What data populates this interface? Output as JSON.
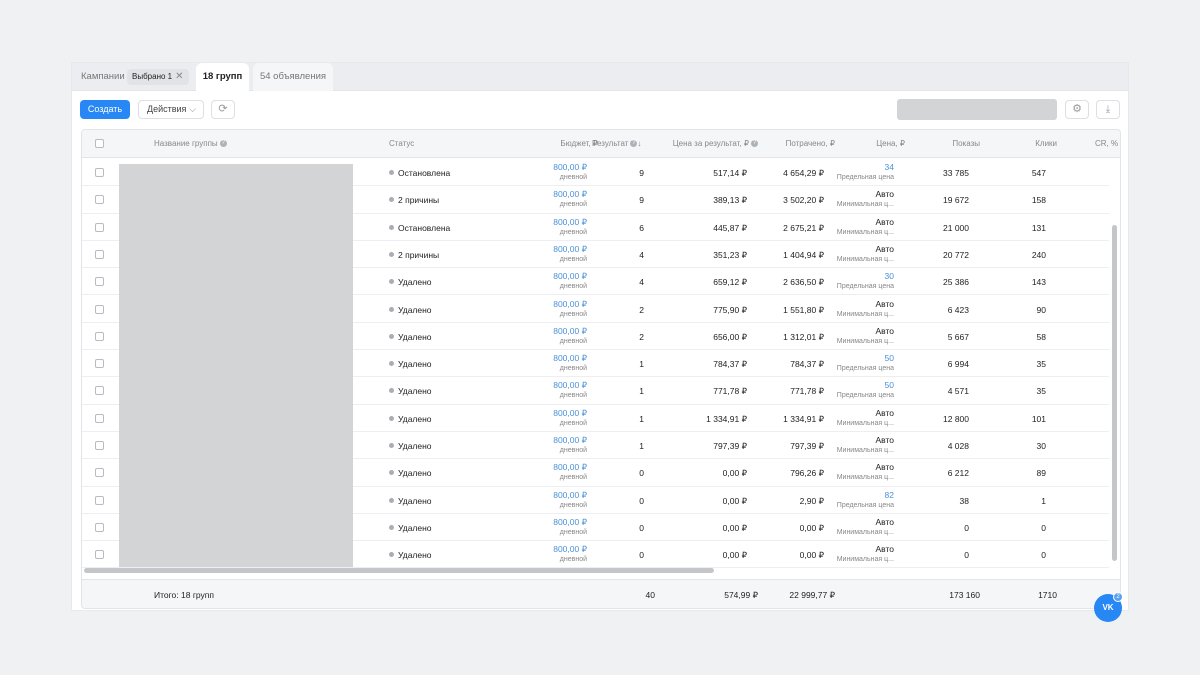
{
  "tabs": {
    "campaigns_label": "Кампании",
    "selected_chip": "Выбрано 1",
    "groups_label": "18 групп",
    "ads_label": "54 объявления"
  },
  "toolbar": {
    "create_label": "Создать",
    "actions_label": "Действия"
  },
  "table": {
    "headers": {
      "name": "Название группы",
      "status": "Статус",
      "budget": "Бюджет, ₽",
      "result": "Результат",
      "cost_per_result": "Цена за результат, ₽",
      "spent": "Потрачено, ₽",
      "price": "Цена, ₽",
      "impressions": "Показы",
      "clicks": "Клики",
      "cr": "CR, %"
    },
    "rows": [
      {
        "status": "Остановлена",
        "budget": "800,00 ₽",
        "budget_sub": "дневной",
        "result": "9",
        "cpr": "517,14 ₽",
        "spent": "4 654,29 ₽",
        "price": "34",
        "price_sub": "Предельная цена",
        "impressions": "33 785",
        "clicks": "547"
      },
      {
        "status": "2 причины",
        "budget": "800,00 ₽",
        "budget_sub": "дневной",
        "result": "9",
        "cpr": "389,13 ₽",
        "spent": "3 502,20 ₽",
        "price": "Авто",
        "price_sub": "Минимальная ц...",
        "impressions": "19 672",
        "clicks": "158"
      },
      {
        "status": "Остановлена",
        "budget": "800,00 ₽",
        "budget_sub": "дневной",
        "result": "6",
        "cpr": "445,87 ₽",
        "spent": "2 675,21 ₽",
        "price": "Авто",
        "price_sub": "Минимальная ц...",
        "impressions": "21 000",
        "clicks": "131"
      },
      {
        "status": "2 причины",
        "budget": "800,00 ₽",
        "budget_sub": "дневной",
        "result": "4",
        "cpr": "351,23 ₽",
        "spent": "1 404,94 ₽",
        "price": "Авто",
        "price_sub": "Минимальная ц...",
        "impressions": "20 772",
        "clicks": "240"
      },
      {
        "status": "Удалено",
        "budget": "800,00 ₽",
        "budget_sub": "дневной",
        "result": "4",
        "cpr": "659,12 ₽",
        "spent": "2 636,50 ₽",
        "price": "30",
        "price_sub": "Предельная цена",
        "impressions": "25 386",
        "clicks": "143"
      },
      {
        "status": "Удалено",
        "budget": "800,00 ₽",
        "budget_sub": "дневной",
        "result": "2",
        "cpr": "775,90 ₽",
        "spent": "1 551,80 ₽",
        "price": "Авто",
        "price_sub": "Минимальная ц...",
        "impressions": "6 423",
        "clicks": "90"
      },
      {
        "status": "Удалено",
        "budget": "800,00 ₽",
        "budget_sub": "дневной",
        "result": "2",
        "cpr": "656,00 ₽",
        "spent": "1 312,01 ₽",
        "price": "Авто",
        "price_sub": "Минимальная ц...",
        "impressions": "5 667",
        "clicks": "58"
      },
      {
        "status": "Удалено",
        "budget": "800,00 ₽",
        "budget_sub": "дневной",
        "result": "1",
        "cpr": "784,37 ₽",
        "spent": "784,37 ₽",
        "price": "50",
        "price_sub": "Предельная цена",
        "impressions": "6 994",
        "clicks": "35"
      },
      {
        "status": "Удалено",
        "budget": "800,00 ₽",
        "budget_sub": "дневной",
        "result": "1",
        "cpr": "771,78 ₽",
        "spent": "771,78 ₽",
        "price": "50",
        "price_sub": "Предельная цена",
        "impressions": "4 571",
        "clicks": "35"
      },
      {
        "status": "Удалено",
        "budget": "800,00 ₽",
        "budget_sub": "дневной",
        "result": "1",
        "cpr": "1 334,91 ₽",
        "spent": "1 334,91 ₽",
        "price": "Авто",
        "price_sub": "Минимальная ц...",
        "impressions": "12 800",
        "clicks": "101"
      },
      {
        "status": "Удалено",
        "budget": "800,00 ₽",
        "budget_sub": "дневной",
        "result": "1",
        "cpr": "797,39 ₽",
        "spent": "797,39 ₽",
        "price": "Авто",
        "price_sub": "Минимальная ц...",
        "impressions": "4 028",
        "clicks": "30"
      },
      {
        "status": "Удалено",
        "budget": "800,00 ₽",
        "budget_sub": "дневной",
        "result": "0",
        "cpr": "0,00 ₽",
        "spent": "796,26 ₽",
        "price": "Авто",
        "price_sub": "Минимальная ц...",
        "impressions": "6 212",
        "clicks": "89"
      },
      {
        "status": "Удалено",
        "budget": "800,00 ₽",
        "budget_sub": "дневной",
        "result": "0",
        "cpr": "0,00 ₽",
        "spent": "2,90 ₽",
        "price": "82",
        "price_sub": "Предельная цена",
        "impressions": "38",
        "clicks": "1"
      },
      {
        "status": "Удалено",
        "budget": "800,00 ₽",
        "budget_sub": "дневной",
        "result": "0",
        "cpr": "0,00 ₽",
        "spent": "0,00 ₽",
        "price": "Авто",
        "price_sub": "Минимальная ц...",
        "impressions": "0",
        "clicks": "0"
      },
      {
        "status": "Удалено",
        "budget": "800,00 ₽",
        "budget_sub": "дневной",
        "result": "0",
        "cpr": "0,00 ₽",
        "spent": "0,00 ₽",
        "price": "Авто",
        "price_sub": "Минимальная ц...",
        "impressions": "0",
        "clicks": "0"
      }
    ],
    "footer": {
      "label": "Итого: 18 групп",
      "result": "40",
      "cpr": "574,99 ₽",
      "spent": "22 999,77 ₽",
      "impressions": "173 160",
      "clicks": "1710"
    }
  },
  "vk_widget": {
    "label": "VK",
    "count": "2"
  }
}
